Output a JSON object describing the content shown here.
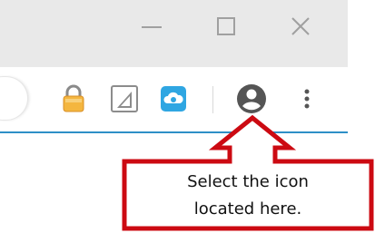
{
  "window": {
    "minimize_icon": "minimize-icon",
    "maximize_icon": "maximize-icon",
    "close_icon": "close-icon"
  },
  "toolbar": {
    "extensions": [
      {
        "name": "lock-extension",
        "icon": "padlock-icon",
        "color": "#f2b63d"
      },
      {
        "name": "play-extension",
        "icon": "play-triangle-icon",
        "color": "#7a7a7a"
      },
      {
        "name": "cloud-extension",
        "icon": "cloud-icon",
        "color": "#31a8e0"
      }
    ],
    "profile_icon": "account-circle-icon",
    "menu_icon": "vertical-dots-icon",
    "accent_line_color": "#2e8fc7"
  },
  "callout": {
    "line1": "Select the icon",
    "line2": "located here.",
    "border_color": "#cc0a12"
  }
}
